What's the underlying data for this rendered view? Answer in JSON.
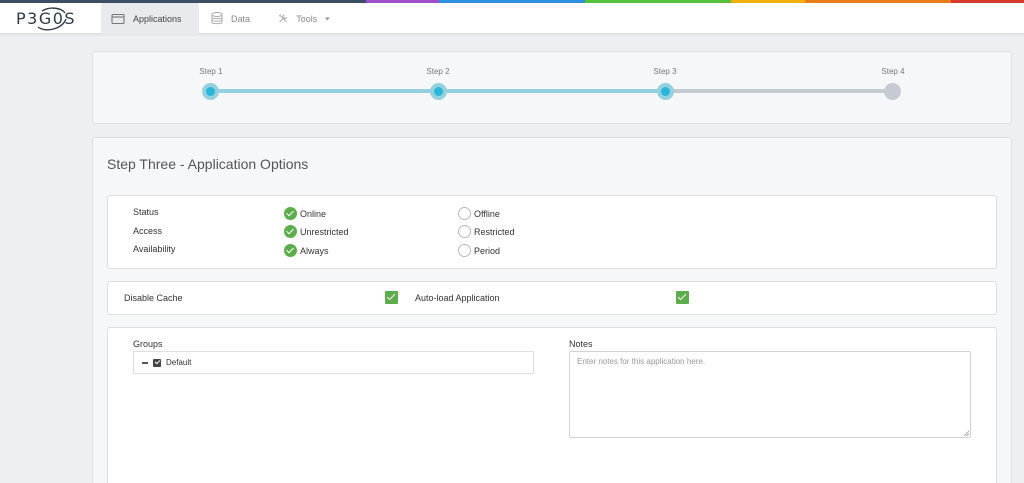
{
  "colors": {
    "bar": [
      "#3b4e63",
      "#3b4e63",
      "#3b4e63",
      "#3b4e63",
      "#3b4e63",
      "#a04fc9",
      "#2f8fe0",
      "#2f8fe0",
      "#56c13b",
      "#56c13b",
      "#f0b010",
      "#e87d18",
      "#e87d18",
      "#d93a2f"
    ],
    "accent": "#29b6d8",
    "check": "#5cae4d"
  },
  "nav": {
    "logo": "P3G0S",
    "tabs": [
      {
        "label": "Applications",
        "icon": "window-icon",
        "active": true
      },
      {
        "label": "Data",
        "icon": "database-icon"
      },
      {
        "label": "Tools",
        "icon": "tools-icon",
        "dropdown": true
      }
    ]
  },
  "wizard": {
    "steps": [
      {
        "label": "Step 1",
        "state": "done"
      },
      {
        "label": "Step 2",
        "state": "done"
      },
      {
        "label": "Step 3",
        "state": "done"
      },
      {
        "label": "Step 4",
        "state": "todo"
      }
    ]
  },
  "form": {
    "title": "Step Three - Application Options",
    "options": [
      {
        "label": "Status",
        "choices": [
          "Online",
          "Offline"
        ],
        "selected": 0
      },
      {
        "label": "Access",
        "choices": [
          "Unrestricted",
          "Restricted"
        ],
        "selected": 0
      },
      {
        "label": "Availability",
        "choices": [
          "Always",
          "Period"
        ],
        "selected": 0
      }
    ],
    "disable_cache_label": "Disable Cache",
    "autoload_label": "Auto-load Application",
    "groups_label": "Groups",
    "groups": [
      {
        "label": "Default",
        "checked": true
      }
    ],
    "notes_label": "Notes",
    "notes_placeholder": "Enter notes for this application here."
  }
}
